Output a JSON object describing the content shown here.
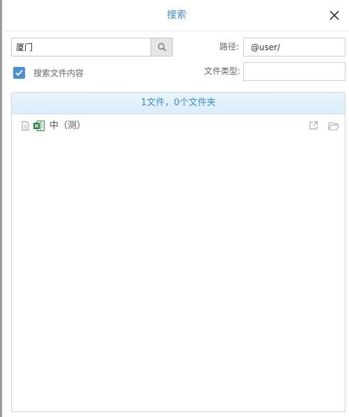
{
  "dialog": {
    "title": "搜索"
  },
  "search": {
    "query": "厦门"
  },
  "path": {
    "label": "路径:",
    "value": "@user/"
  },
  "file_type": {
    "label": "文件类型:",
    "value": ""
  },
  "content_search": {
    "label": "搜索文件内容",
    "checked": true
  },
  "results": {
    "summary": "1文件，0个文件夹",
    "items": [
      {
        "name": "中（测）",
        "icon": "excel-file-icon"
      }
    ]
  },
  "colors": {
    "accent": "#3a8fd0",
    "checkbox": "#4a90d9",
    "results_header_bg": "#e4f1fc",
    "excel_green": "#1f7a3a"
  }
}
